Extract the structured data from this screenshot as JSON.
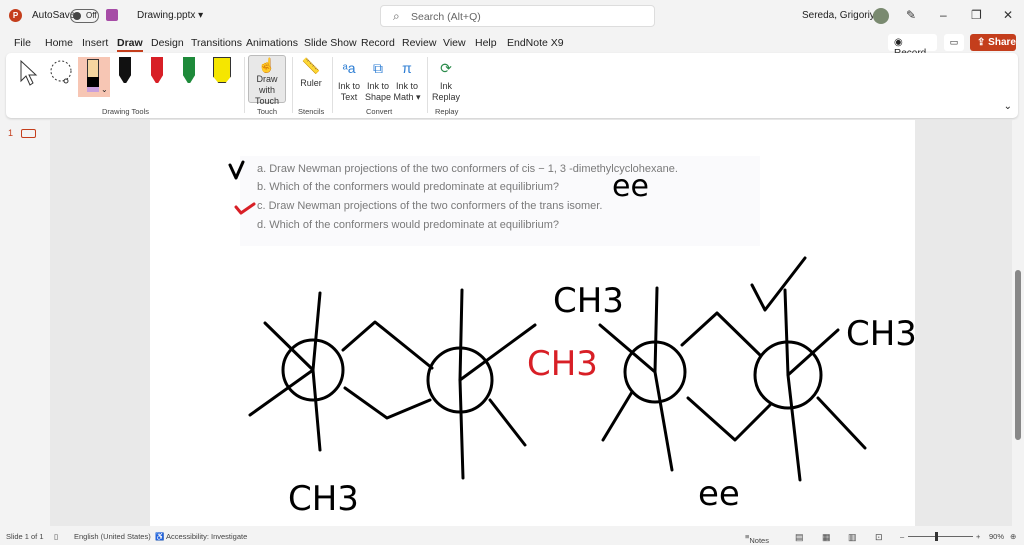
{
  "titlebar": {
    "app_logo": "P",
    "autosave_label": "AutoSave",
    "autosave_state": "Off",
    "document_name": "Drawing.pptx ▾",
    "search_placeholder": "Search (Alt+Q)",
    "user_name": "Sereda, Grigoriy A"
  },
  "tabs": [
    "File",
    "Home",
    "Insert",
    "Draw",
    "Design",
    "Transitions",
    "Animations",
    "Slide Show",
    "Record",
    "Review",
    "View",
    "Help",
    "EndNote X9"
  ],
  "active_tab": "Draw",
  "actions": {
    "record": "Record",
    "share": "Share"
  },
  "ribbon": {
    "groups": {
      "drawing_tools": "Drawing Tools",
      "touch": "Touch",
      "stencils": "Stencils",
      "convert": "Convert",
      "replay": "Replay"
    },
    "draw_with_touch": [
      "Draw with",
      "Touch"
    ],
    "ruler": "Ruler",
    "ink_to_text": [
      "Ink to",
      "Text"
    ],
    "ink_to_shape": [
      "Ink to",
      "Shape"
    ],
    "ink_to_math": [
      "Ink to",
      "Math ▾"
    ],
    "ink_replay": [
      "Ink",
      "Replay"
    ],
    "pen_colors": [
      "#111111",
      "#d81f26",
      "#1e8a3a",
      "#f5e600"
    ]
  },
  "thumbnail": {
    "number": "1"
  },
  "slide": {
    "questions": [
      "a. Draw Newman projections of the two conformers of cis − 1, 3 -dimethylcyclohexane.",
      "b. Which of the conformers would predominate at equilibrium?",
      "c. Draw Newman projections of the two conformers of the trans isomer.",
      "d. Which of the conformers would predominate at equilibrium?"
    ],
    "ink_labels": {
      "ch3_top_left": "CH3",
      "ch3_red": "CH3",
      "ch3_bottom": "CH3",
      "ch3_right": "CH3",
      "ee_answer": "ee",
      "ee_bottom": "ee"
    }
  },
  "status": {
    "slide": "Slide 1 of 1",
    "language": "English (United States)",
    "accessibility": "Accessibility: Investigate",
    "notes": "Notes",
    "zoom": "90%"
  }
}
